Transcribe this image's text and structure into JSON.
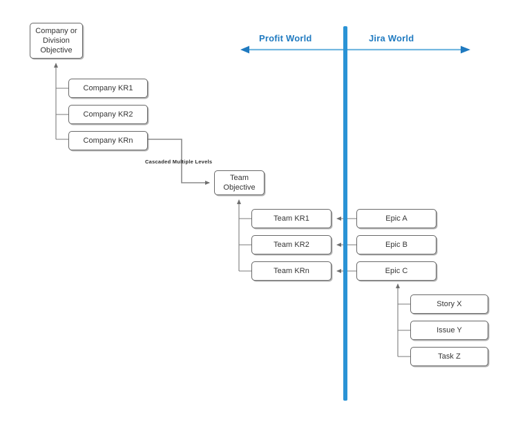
{
  "diagram": {
    "title_left": "Profit World",
    "title_right": "Jira World",
    "divider": {
      "color": "#2a93d5"
    },
    "edge_label_cascade": "Cascaded Multiple Levels",
    "nodes": {
      "company_objective": "Company or\nDivision\nObjective",
      "company_kr1": "Company KR1",
      "company_kr2": "Company KR2",
      "company_krn": "Company KRn",
      "team_objective": "Team\nObjective",
      "team_kr1": "Team KR1",
      "team_kr2": "Team KR2",
      "team_krn": "Team KRn",
      "epic_a": "Epic A",
      "epic_b": "Epic B",
      "epic_c": "Epic C",
      "story_x": "Story X",
      "issue_y": "Issue Y",
      "task_z": "Task Z"
    },
    "colors": {
      "accent": "#2a93d5",
      "label_blue": "#1f7ac0",
      "node_border": "#666666",
      "node_text": "#333333",
      "connector": "#7a7a7a"
    }
  }
}
